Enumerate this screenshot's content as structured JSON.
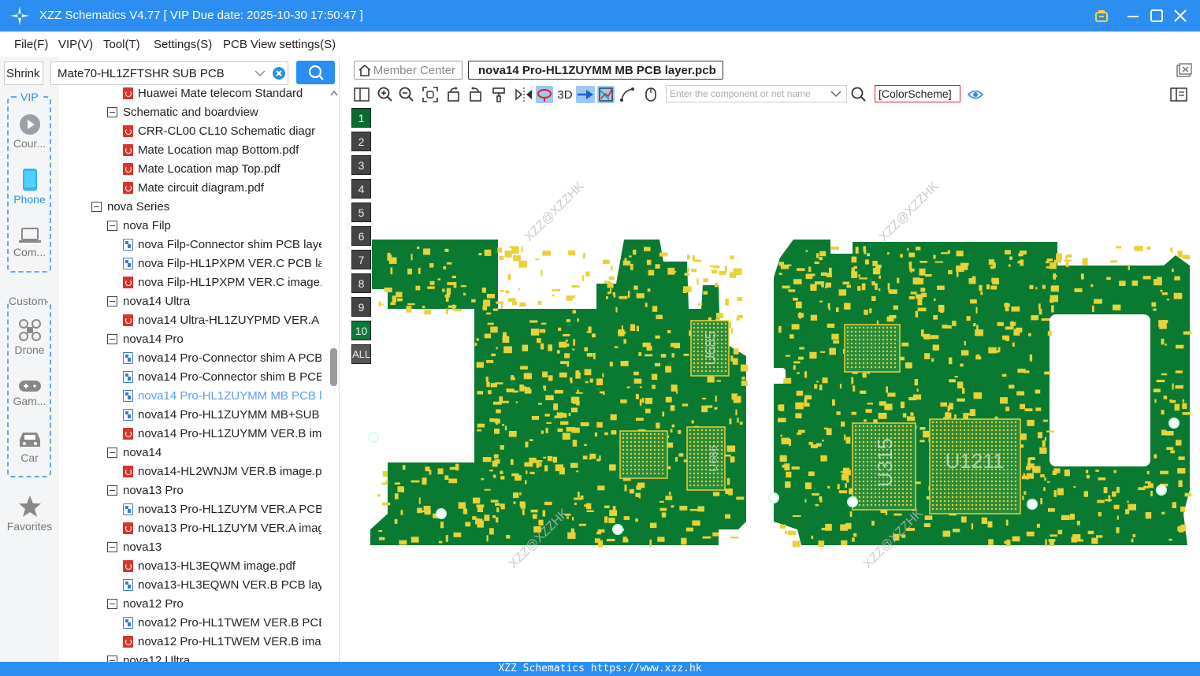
{
  "title_bar": {
    "title": "XZZ Schematics V4.77 [ VIP Due date: 2025-10-30 17:50:47 ]"
  },
  "menu": {
    "items": [
      "File(F)",
      "VIP(V)",
      "Tool(T)",
      "Settings(S)",
      "PCB View settings(S)"
    ]
  },
  "left_nav": {
    "shrink_label": "Shrink",
    "vip_label": "VIP",
    "custom_label": "Custom",
    "items": [
      {
        "label": "Cour...",
        "icon": "play-icon"
      },
      {
        "label": "Phone",
        "icon": "phone-icon",
        "active": true
      },
      {
        "label": "Com...",
        "icon": "laptop-icon"
      },
      {
        "label": "Drone",
        "icon": "drone-icon"
      },
      {
        "label": "Gam...",
        "icon": "gamepad-icon"
      },
      {
        "label": "Car",
        "icon": "car-icon"
      },
      {
        "label": "Favorites",
        "icon": "star-icon"
      }
    ]
  },
  "search": {
    "value": "Mate70-HL1ZFTSHR SUB PCB"
  },
  "tree": {
    "rows": [
      {
        "level": 3,
        "type": "pdf",
        "label": "Huawei Mate telecom Standard"
      },
      {
        "level": 2,
        "type": "folder",
        "label": "Schematic and boardview"
      },
      {
        "level": 3,
        "type": "pdf",
        "label": "CRR-CL00 CL10 Schematic diagr"
      },
      {
        "level": 3,
        "type": "pdf",
        "label": "Mate Location map Bottom.pdf"
      },
      {
        "level": 3,
        "type": "pdf",
        "label": "Mate Location map Top.pdf"
      },
      {
        "level": 3,
        "type": "pdf",
        "label": "Mate circuit diagram.pdf"
      },
      {
        "level": 1,
        "type": "folder",
        "label": "nova Series"
      },
      {
        "level": 2,
        "type": "folder",
        "label": "nova Filp"
      },
      {
        "level": 3,
        "type": "pcb",
        "label": "nova Filp-Connector shim PCB laye"
      },
      {
        "level": 3,
        "type": "pcb",
        "label": "nova Filp-HL1PXPM VER.C PCB lay"
      },
      {
        "level": 3,
        "type": "pdf",
        "label": "nova Filp-HL1PXPM VER.C image.p"
      },
      {
        "level": 2,
        "type": "folder",
        "label": "nova14 Ultra"
      },
      {
        "level": 3,
        "type": "pdf",
        "label": "nova14 Ultra-HL1ZUYPMD VER.A i"
      },
      {
        "level": 2,
        "type": "folder",
        "label": "nova14 Pro"
      },
      {
        "level": 3,
        "type": "pcb",
        "label": "nova14 Pro-Connector shim A PCB"
      },
      {
        "level": 3,
        "type": "pcb",
        "label": "nova14 Pro-Connector shim B PCB"
      },
      {
        "level": 3,
        "type": "pcb",
        "label": "nova14 Pro-HL1ZUYMM MB PCB l",
        "selected": true
      },
      {
        "level": 3,
        "type": "pcb",
        "label": "nova14 Pro-HL1ZUYMM MB+SUB"
      },
      {
        "level": 3,
        "type": "pdf",
        "label": "nova14 Pro-HL1ZUYMM VER.B ima"
      },
      {
        "level": 2,
        "type": "folder",
        "label": "nova14"
      },
      {
        "level": 3,
        "type": "pdf",
        "label": "nova14-HL2WNJM VER.B image.pc"
      },
      {
        "level": 2,
        "type": "folder",
        "label": "nova13 Pro"
      },
      {
        "level": 3,
        "type": "pcb",
        "label": "nova13 Pro-HL1ZUYM VER.A PCB l"
      },
      {
        "level": 3,
        "type": "pdf",
        "label": "nova13 Pro-HL1ZUYM VER.A imag"
      },
      {
        "level": 2,
        "type": "folder",
        "label": "nova13"
      },
      {
        "level": 3,
        "type": "pdf",
        "label": "nova13-HL3EQWM image.pdf"
      },
      {
        "level": 3,
        "type": "pcb",
        "label": "nova13-HL3EQWN VER.B PCB layer"
      },
      {
        "level": 2,
        "type": "folder",
        "label": "nova12 Pro"
      },
      {
        "level": 3,
        "type": "pcb",
        "label": "nova12 Pro-HL1TWEM VER.B PCB l"
      },
      {
        "level": 3,
        "type": "pdf",
        "label": "nova12 Pro-HL1TWEM VER.B imag"
      },
      {
        "level": 2,
        "type": "folder",
        "label": "nova12 Ultra"
      }
    ]
  },
  "tabs": {
    "member_center": "Member Center",
    "active_file": "nova14 Pro-HL1ZUYMM MB PCB layer.pcb"
  },
  "toolbar": {
    "label_3d": "3D",
    "component_placeholder": "Enter the component or net name",
    "color_scheme": "[ColorScheme]"
  },
  "layers": [
    "1",
    "2",
    "3",
    "4",
    "5",
    "6",
    "7",
    "8",
    "9",
    "10",
    "ALL"
  ],
  "active_layer": "1",
  "pcb": {
    "watermark": "XZZ@XZZHK",
    "chip_labels": [
      "U685",
      "U686",
      "U315",
      "U1211"
    ]
  },
  "status_bar": {
    "text": "XZZ Schematics https://www.xzz.hk"
  },
  "colors": {
    "accent": "#2b8ef0",
    "board_green": "#0a7a32",
    "pad_yellow": "#e8d23a"
  }
}
